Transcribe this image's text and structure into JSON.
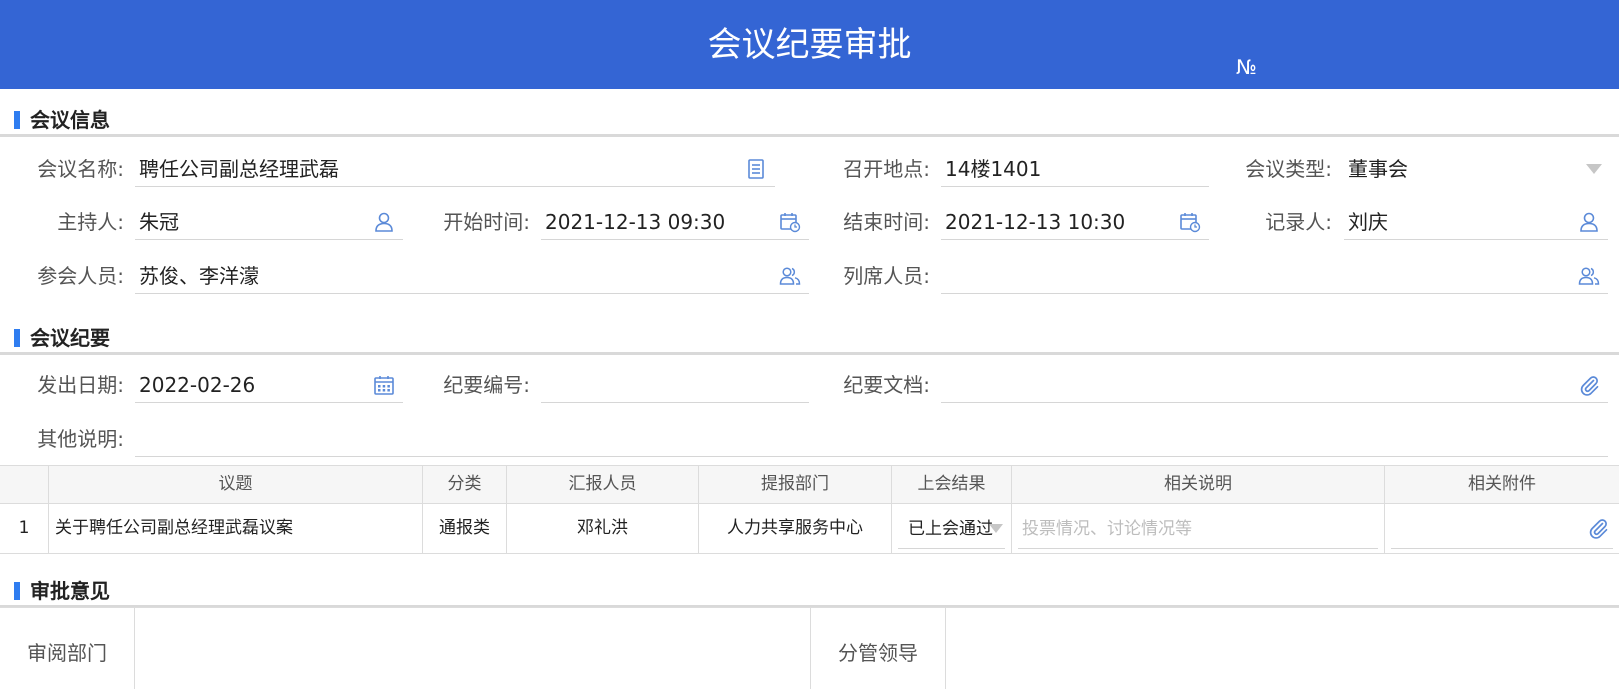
{
  "header": {
    "title": "会议纪要审批",
    "no_label": "№"
  },
  "sections": {
    "meeting_info": "会议信息",
    "minutes": "会议纪要",
    "approval": "审批意见"
  },
  "meeting": {
    "name_label": "会议名称:",
    "name_value": "聘任公司副总经理武磊",
    "location_label": "召开地点:",
    "location_value": "14楼1401",
    "type_label": "会议类型:",
    "type_value": "董事会",
    "host_label": "主持人:",
    "host_value": "朱冠",
    "start_label": "开始时间:",
    "start_value": "2021-12-13 09:30",
    "end_label": "结束时间:",
    "end_value": "2021-12-13 10:30",
    "recorder_label": "记录人:",
    "recorder_value": "刘庆",
    "attendees_label": "参会人员:",
    "attendees_value": "苏俊、李洋濛",
    "observers_label": "列席人员:",
    "observers_value": ""
  },
  "minutes": {
    "date_label": "发出日期:",
    "date_value": "2022-02-26",
    "number_label": "纪要编号:",
    "number_value": "",
    "doc_label": "纪要文档:",
    "doc_value": "",
    "notes_label": "其他说明:",
    "notes_value": ""
  },
  "table": {
    "headers": [
      "议题",
      "分类",
      "汇报人员",
      "提报部门",
      "上会结果",
      "相关说明",
      "相关附件"
    ],
    "rows": [
      {
        "index": "1",
        "topic": "关于聘任公司副总经理武磊议案",
        "category": "通报类",
        "reporter": "邓礼洪",
        "dept": "人力共享服务中心",
        "result": "已上会通过",
        "remark_placeholder": "投票情况、讨论情况等",
        "attachment": ""
      }
    ]
  },
  "approval": {
    "review_dept_label": "审阅部门",
    "leader_label": "分管领导"
  },
  "colors": {
    "header_bg": "#3465d4",
    "accent": "#2f7df0",
    "icon": "#5b8ad8"
  }
}
